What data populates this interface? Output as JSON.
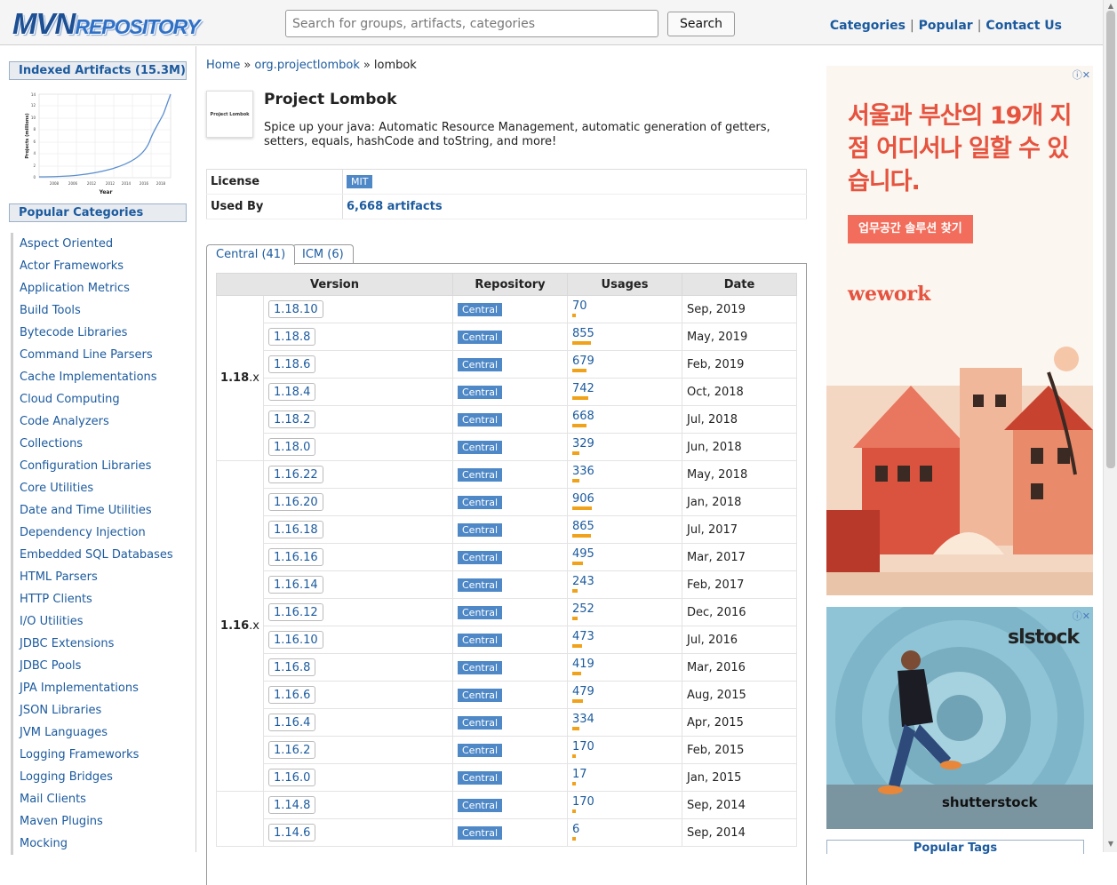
{
  "header": {
    "logo_mvn": "MVN",
    "logo_repo": "REPOSITORY",
    "search_placeholder": "Search for groups, artifacts, categories",
    "search_button": "Search",
    "nav": [
      "Categories",
      "Popular",
      "Contact Us"
    ]
  },
  "sidebar": {
    "indexed_title": "Indexed Artifacts (15.3M)",
    "chart": {
      "ylabel": "Projects (millions)",
      "xlabel": "Year",
      "x_ticks": [
        "2008",
        "2006",
        "2012",
        "2012",
        "2014",
        "2016",
        "2018"
      ],
      "y_ticks": [
        "0",
        "2",
        "4",
        "6",
        "8",
        "10",
        "12",
        "14"
      ]
    },
    "popular_title": "Popular Categories",
    "categories": [
      "Aspect Oriented",
      "Actor Frameworks",
      "Application Metrics",
      "Build Tools",
      "Bytecode Libraries",
      "Command Line Parsers",
      "Cache Implementations",
      "Cloud Computing",
      "Code Analyzers",
      "Collections",
      "Configuration Libraries",
      "Core Utilities",
      "Date and Time Utilities",
      "Dependency Injection",
      "Embedded SQL Databases",
      "HTML Parsers",
      "HTTP Clients",
      "I/O Utilities",
      "JDBC Extensions",
      "JDBC Pools",
      "JPA Implementations",
      "JSON Libraries",
      "JVM Languages",
      "Logging Frameworks",
      "Logging Bridges",
      "Mail Clients",
      "Maven Plugins",
      "Mocking"
    ]
  },
  "breadcrumb": {
    "home": "Home",
    "group": "org.projectlombok",
    "artifact": "lombok",
    "sep": "»"
  },
  "project": {
    "logo_text": "Project Lombok",
    "title": "Project Lombok",
    "description": "Spice up your java: Automatic Resource Management, automatic generation of getters, setters, equals, hashCode and toString, and more!"
  },
  "info": {
    "license_label": "License",
    "license_value": "MIT",
    "used_by_label": "Used By",
    "used_by_value": "6,668 artifacts"
  },
  "tabs": [
    "Central (41)",
    "ICM (6)"
  ],
  "versions_table": {
    "headers": [
      "Version",
      "Repository",
      "Usages",
      "Date"
    ],
    "groups": [
      {
        "label": "1.18",
        "suffix": ".x",
        "rows": [
          {
            "version": "1.18.10",
            "repo": "Central",
            "usages": "70",
            "date": "Sep, 2019"
          },
          {
            "version": "1.18.8",
            "repo": "Central",
            "usages": "855",
            "date": "May, 2019"
          },
          {
            "version": "1.18.6",
            "repo": "Central",
            "usages": "679",
            "date": "Feb, 2019"
          },
          {
            "version": "1.18.4",
            "repo": "Central",
            "usages": "742",
            "date": "Oct, 2018"
          },
          {
            "version": "1.18.2",
            "repo": "Central",
            "usages": "668",
            "date": "Jul, 2018"
          },
          {
            "version": "1.18.0",
            "repo": "Central",
            "usages": "329",
            "date": "Jun, 2018"
          }
        ]
      },
      {
        "label": "1.16",
        "suffix": ".x",
        "rows": [
          {
            "version": "1.16.22",
            "repo": "Central",
            "usages": "336",
            "date": "May, 2018"
          },
          {
            "version": "1.16.20",
            "repo": "Central",
            "usages": "906",
            "date": "Jan, 2018"
          },
          {
            "version": "1.16.18",
            "repo": "Central",
            "usages": "865",
            "date": "Jul, 2017"
          },
          {
            "version": "1.16.16",
            "repo": "Central",
            "usages": "495",
            "date": "Mar, 2017"
          },
          {
            "version": "1.16.14",
            "repo": "Central",
            "usages": "243",
            "date": "Feb, 2017"
          },
          {
            "version": "1.16.12",
            "repo": "Central",
            "usages": "252",
            "date": "Dec, 2016"
          },
          {
            "version": "1.16.10",
            "repo": "Central",
            "usages": "473",
            "date": "Jul, 2016"
          },
          {
            "version": "1.16.8",
            "repo": "Central",
            "usages": "419",
            "date": "Mar, 2016"
          },
          {
            "version": "1.16.6",
            "repo": "Central",
            "usages": "479",
            "date": "Aug, 2015"
          },
          {
            "version": "1.16.4",
            "repo": "Central",
            "usages": "334",
            "date": "Apr, 2015"
          },
          {
            "version": "1.16.2",
            "repo": "Central",
            "usages": "170",
            "date": "Feb, 2015"
          },
          {
            "version": "1.16.0",
            "repo": "Central",
            "usages": "17",
            "date": "Jan, 2015"
          }
        ]
      },
      {
        "label": "",
        "suffix": "",
        "rows": [
          {
            "version": "1.14.8",
            "repo": "Central",
            "usages": "170",
            "date": "Sep, 2014"
          },
          {
            "version": "1.14.6",
            "repo": "Central",
            "usages": "6",
            "date": "Sep, 2014"
          }
        ]
      }
    ]
  },
  "ads": {
    "close_icon": "ⓘ✕",
    "ad1_headline": "서울과 부산의 19개 지점 어디서나 일할 수 있습니다.",
    "ad1_cta": "업무공간 솔루션 찾기",
    "ad1_brand": "wework",
    "ad2_brand": "slstock",
    "ad2_footer": "shutterstock"
  },
  "popular_tags_title": "Popular Tags",
  "colors": {
    "link": "#1b5a9e",
    "badge": "#4e88c7",
    "usage_bar": "#f0a21a"
  }
}
